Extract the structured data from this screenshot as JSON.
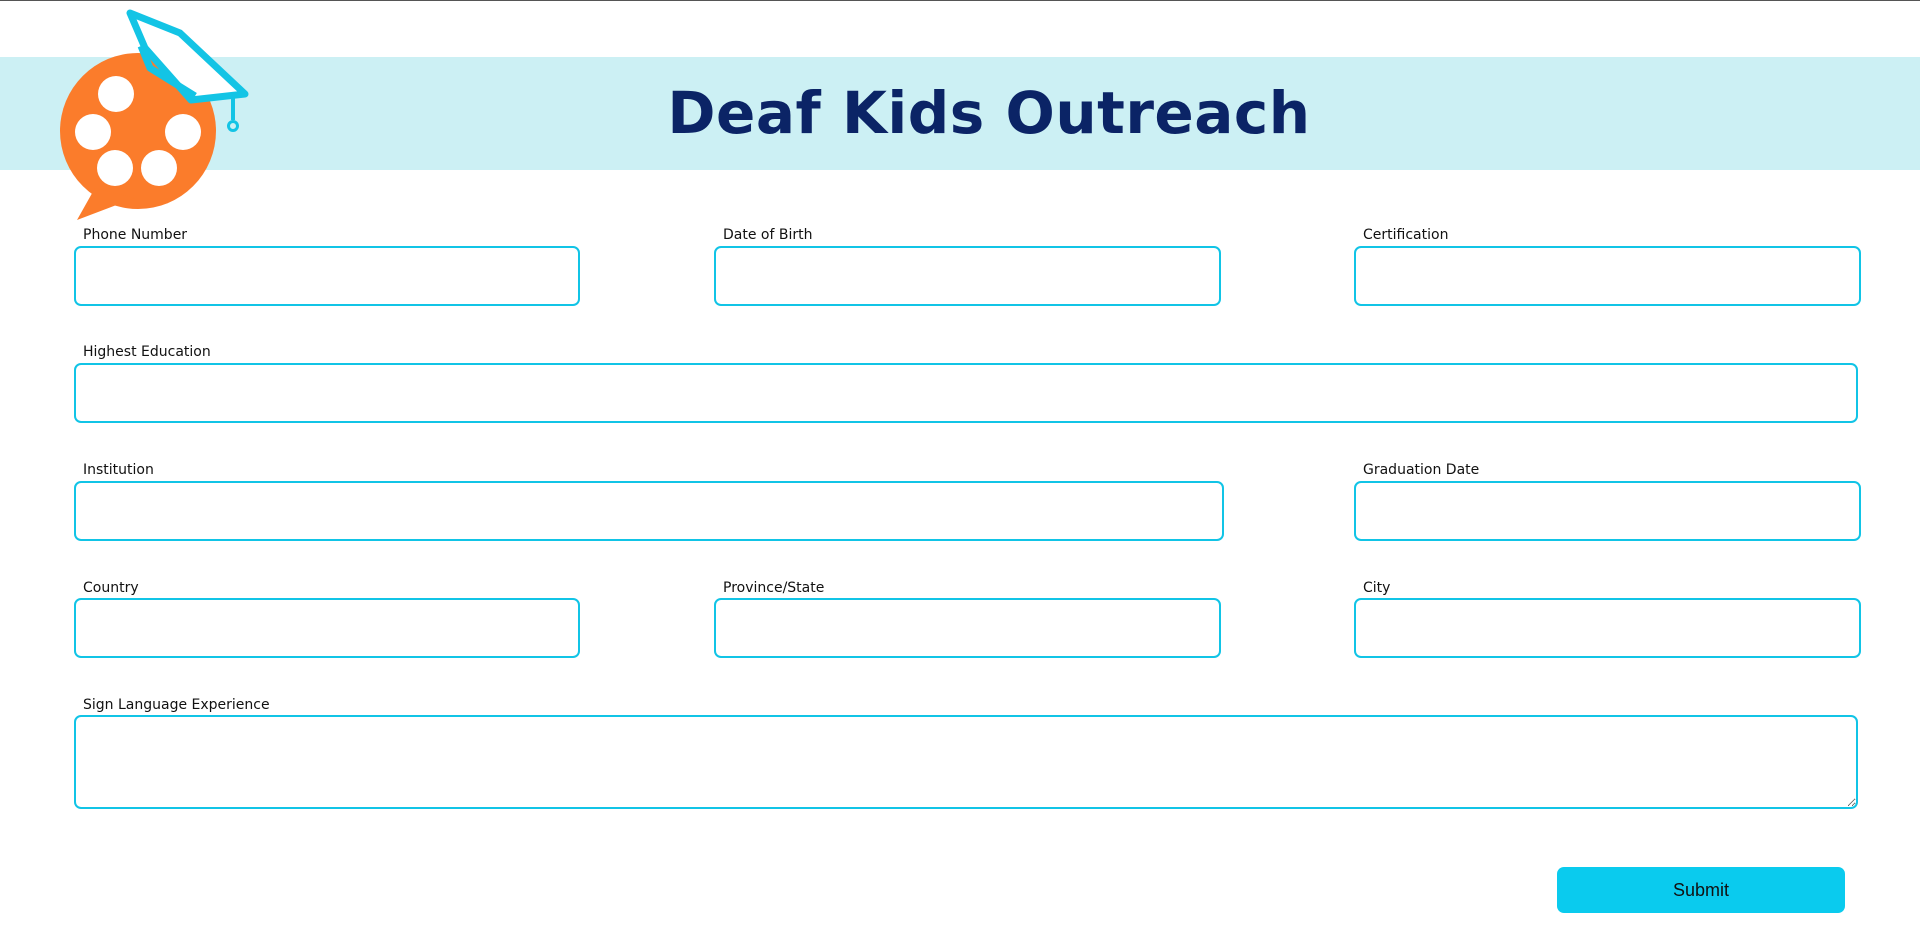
{
  "header": {
    "title": "Deaf Kids Outreach",
    "logo_icon": "speech-bubble-graduation-cap-logo",
    "colors": {
      "banner_bg": "#ccf0f4",
      "title": "#0b2466",
      "logo_orange": "#fb7c2b",
      "logo_cyan": "#13c4e5"
    }
  },
  "form": {
    "accent_color": "#11c4e6",
    "fields": {
      "phone_number": {
        "label": "Phone Number",
        "value": ""
      },
      "date_of_birth": {
        "label": "Date of Birth",
        "value": ""
      },
      "certification": {
        "label": "Certification",
        "value": ""
      },
      "highest_education": {
        "label": "Highest Education",
        "value": ""
      },
      "institution": {
        "label": "Institution",
        "value": ""
      },
      "graduation_date": {
        "label": "Graduation Date",
        "value": ""
      },
      "country": {
        "label": "Country",
        "value": ""
      },
      "province_state": {
        "label": "Province/State",
        "value": ""
      },
      "city": {
        "label": "City",
        "value": ""
      },
      "sign_language_experience": {
        "label": "Sign Language Experience",
        "value": ""
      }
    },
    "submit_label": "Submit",
    "submit_color": "#0acbee"
  }
}
